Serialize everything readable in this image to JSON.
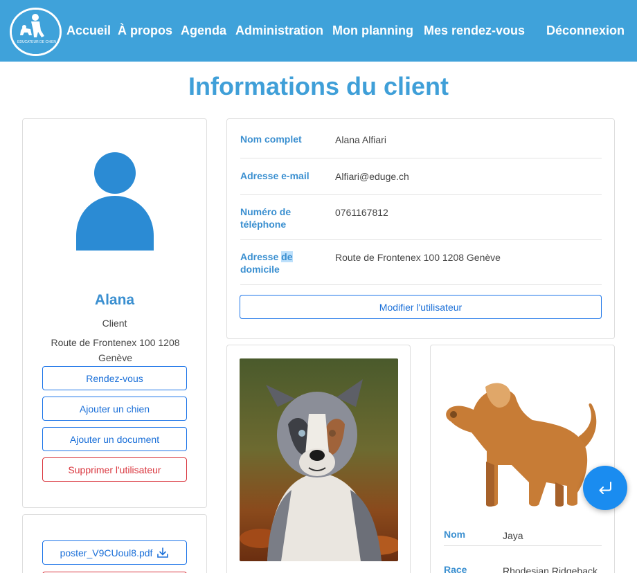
{
  "nav": {
    "logo_text": "ÉDUCATEUR DE CHIEN",
    "links": [
      "Accueil",
      "À propos",
      "Agenda",
      "Administration",
      "Mon planning",
      "Mes rendez-vous"
    ],
    "logout": "Déconnexion"
  },
  "page": {
    "title": "Informations du client"
  },
  "client": {
    "name": "Alana",
    "role": "Client",
    "address": "Route de Frontenex 100 1208 Genève",
    "buttons": {
      "appointments": "Rendez-vous",
      "add_dog": "Ajouter un chien",
      "add_document": "Ajouter un document",
      "delete_user": "Supprimer l'utilisateur"
    }
  },
  "documents": [
    {
      "filename": "poster_V9CUoul8.pdf"
    }
  ],
  "info": {
    "full_name": {
      "label": "Nom complet",
      "value": "Alana Alfiari"
    },
    "email": {
      "label": "Adresse e-mail",
      "value": "Alfiari@eduge.ch"
    },
    "phone": {
      "label_line1": "Numéro de",
      "label_line2": "téléphone",
      "value": "0761167812"
    },
    "home_address": {
      "label_part1": "Adresse ",
      "label_highlight": "de",
      "label_line2": "domicile",
      "value": "Route de Frontenex 100 1208 Genève"
    },
    "edit_button": "Modifier l'utilisateur"
  },
  "dog": {
    "name_label": "Nom",
    "name_value": "Jaya",
    "breed_label": "Race",
    "breed_value": "Rhodesian Ridgeback"
  },
  "colors": {
    "nav_bg": "#3fa2da",
    "title": "#3f9fd8",
    "accent": "#3a8fd0",
    "button_border": "#1a73e8",
    "danger": "#d9363e",
    "fab": "#1a8cf0"
  },
  "icons": {
    "download": "download-icon",
    "fab": "return-arrow-icon",
    "avatar": "user-avatar-icon",
    "dog": "dog-illustration-icon"
  }
}
